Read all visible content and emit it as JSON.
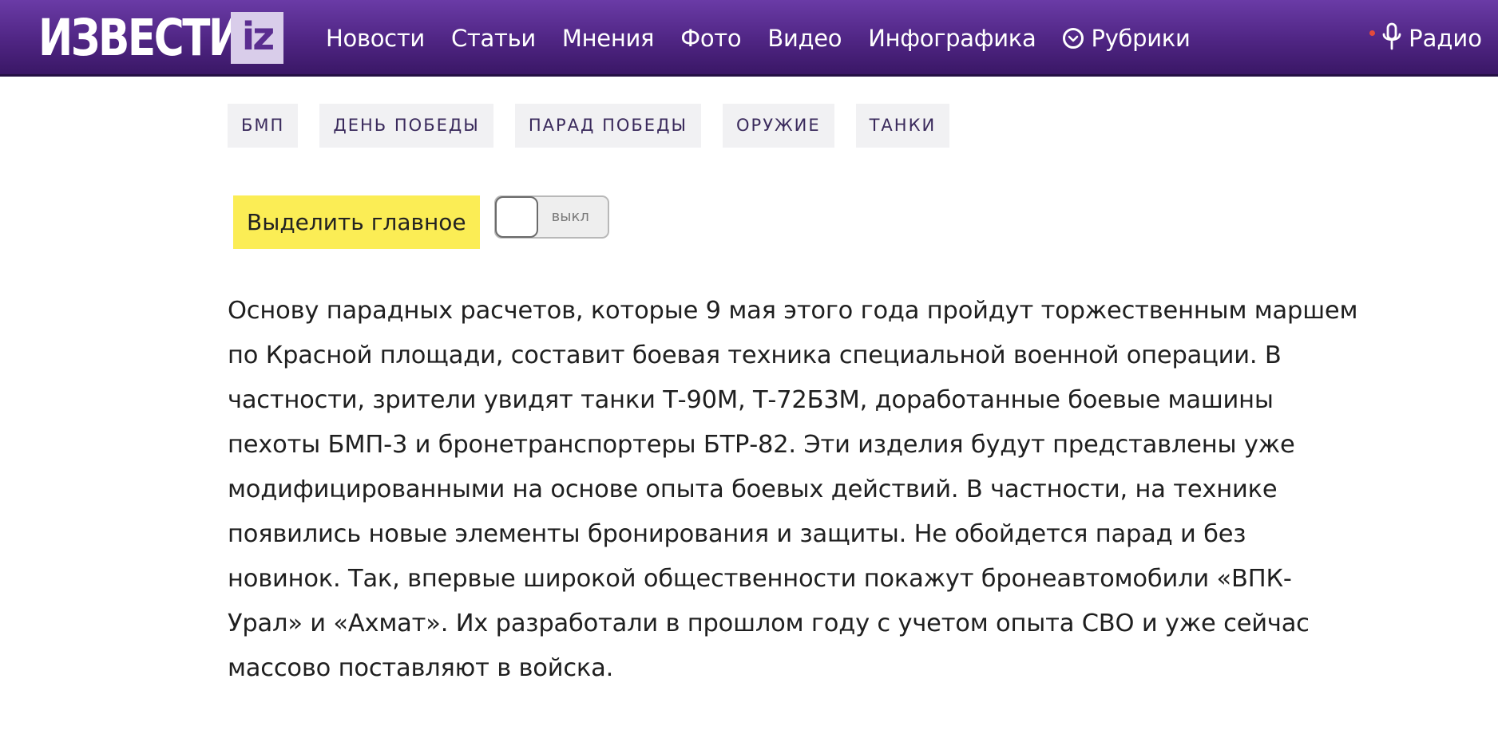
{
  "header": {
    "logo_text": "ИЗВЕСТИЯ",
    "logo_badge": "iz",
    "nav": [
      {
        "label": "Новости"
      },
      {
        "label": "Статьи"
      },
      {
        "label": "Мнения"
      },
      {
        "label": "Фото"
      },
      {
        "label": "Видео"
      },
      {
        "label": "Инфографика"
      },
      {
        "label": "Рубрики",
        "icon": "chevron-down-circle-icon"
      }
    ],
    "radio_label": "Радио",
    "radio_icon": "microphone-icon",
    "live_dot_color": "#e34a3b"
  },
  "tags": [
    {
      "label": "БМП"
    },
    {
      "label": "ДЕНЬ ПОБЕДЫ"
    },
    {
      "label": "ПАРАД ПОБЕДЫ"
    },
    {
      "label": "ОРУЖИЕ"
    },
    {
      "label": "ТАНКИ"
    }
  ],
  "highlight": {
    "label": "Выделить главное",
    "toggle_state_label": "выкл",
    "enabled": false
  },
  "article": {
    "lines": [
      "Основу парадных расчетов, которые 9 мая этого года пройдут торжественным маршем",
      "по Красной площади, составит боевая техника специальной военной операции. В",
      "частности, зрители увидят танки Т-90М, Т-72Б3М, доработанные боевые машины",
      "пехоты БМП-3 и бронетранспортеры БТР-82. Эти изделия будут представлены уже",
      "модифицированными на основе опыта боевых действий. В частности, на технике",
      "появились новые элементы бронирования и защиты. Не обойдется парад и без",
      "новинок. Так, впервые широкой общественности покажут бронеавтомобили «ВПК-",
      "Урал» и «Ахмат». Их разработали в прошлом году с учетом опыта СВО и уже сейчас",
      "массово поставляют в войска."
    ]
  },
  "colors": {
    "header_purple": "#4f2583",
    "highlight_yellow": "#fbed55",
    "tag_bg": "#f1f1f3",
    "tag_text": "#3a2a5c"
  }
}
